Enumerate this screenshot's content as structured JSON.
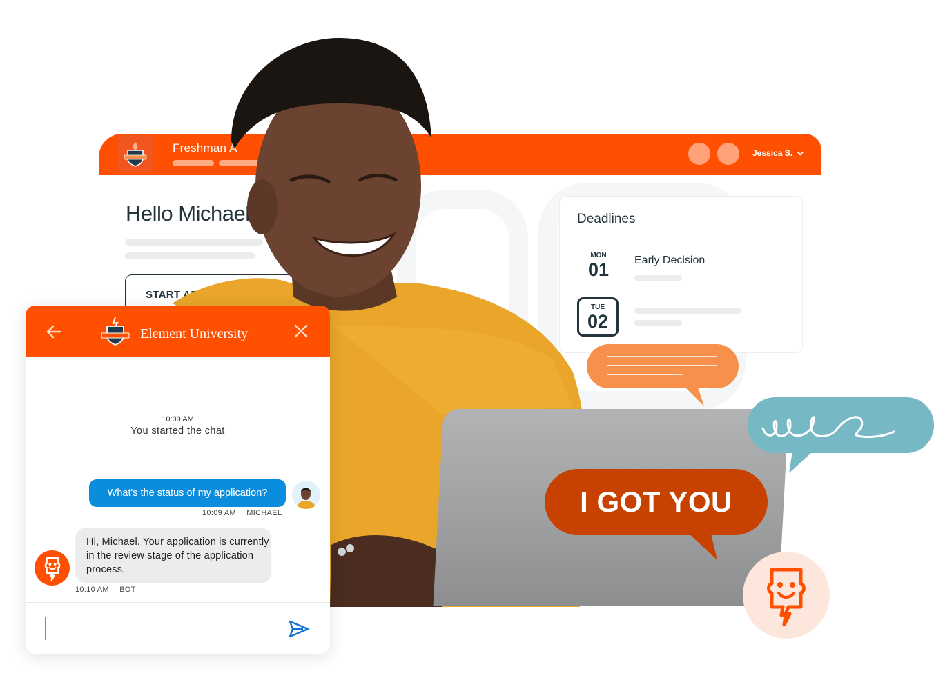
{
  "dashboard": {
    "title": "Freshman A",
    "user_name": "Jessica S.",
    "greeting": "Hello Michael,",
    "start_button": "START APPLICATION",
    "deadlines": {
      "title": "Deadlines",
      "items": [
        {
          "dow": "MON",
          "day": "01",
          "label": "Early Decision"
        },
        {
          "dow": "TUE",
          "day": "02",
          "label": ""
        }
      ]
    }
  },
  "chat": {
    "brand": "Element University",
    "system_time": "10:09 AM",
    "system_message": "You started the chat",
    "messages": [
      {
        "sender": "MICHAEL",
        "time": "10:09 AM",
        "text": "What's the status of my application?"
      },
      {
        "sender": "BOT",
        "time": "10:10 AM",
        "text": "Hi, Michael. Your application is currently in the review stage of the application process."
      }
    ],
    "input_value": "",
    "input_placeholder": ""
  },
  "callouts": {
    "big_bubble": "I GOT YOU"
  },
  "colors": {
    "brand_orange": "#fe5000",
    "chat_blue": "#0a8ddc",
    "bubble_orange": "#f7904a",
    "bubble_teal": "#76b8c4",
    "bubble_red": "#c74200",
    "text_dark": "#22343c"
  }
}
